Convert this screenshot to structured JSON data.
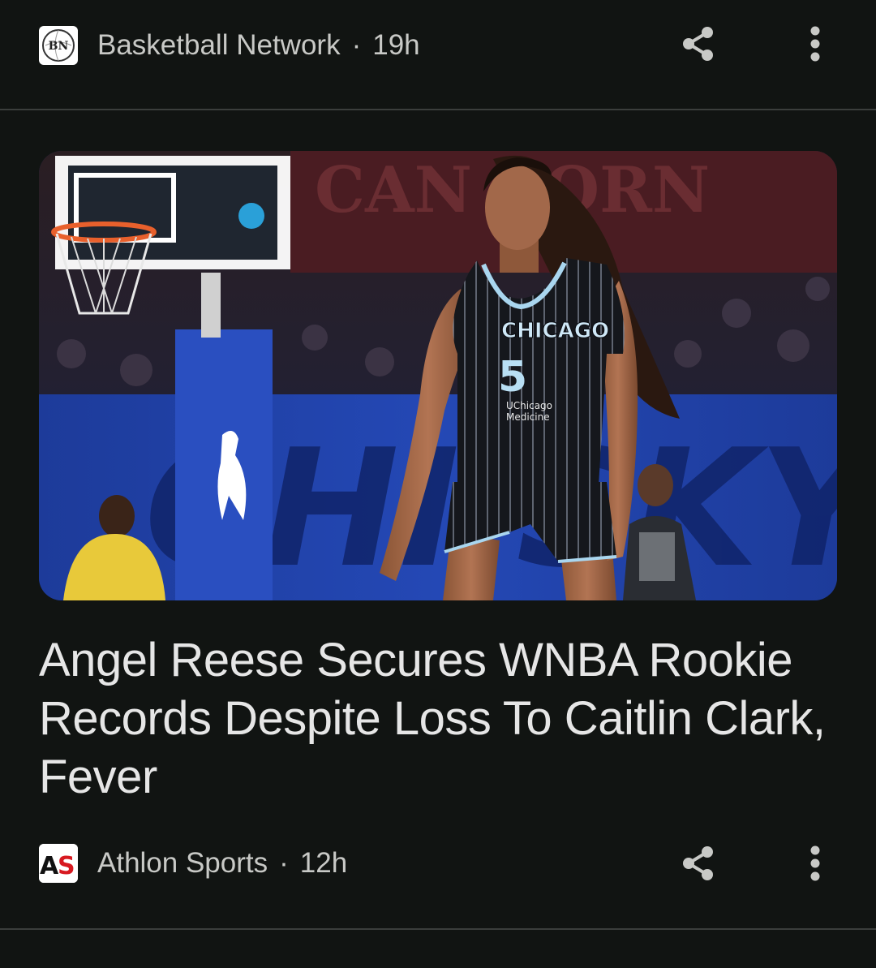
{
  "articles": [
    {
      "source": {
        "name": "Basketball Network",
        "logo_text": "BN",
        "age": "19h",
        "separator": "·"
      }
    },
    {
      "headline": "Angel Reese Secures WNBA Rookie Records Despite Loss To Caitlin Clark, Fever",
      "image": {
        "jersey_team": "CHICAGO",
        "jersey_number": "5",
        "jersey_sponsor_line1": "UChicago",
        "jersey_sponsor_line2": "Medicine",
        "banner_text": "CAN CORN"
      },
      "source": {
        "name": "Athlon Sports",
        "logo_text": "AS",
        "age": "12h",
        "separator": "·"
      }
    }
  ],
  "icons": {
    "share": "share-icon",
    "more": "more-vert-icon"
  },
  "colors": {
    "background": "#111412",
    "text": "#e3e3e3",
    "secondary_text": "#c8c9c6",
    "divider": "#3b3e3c",
    "athlon_red": "#d71920"
  }
}
